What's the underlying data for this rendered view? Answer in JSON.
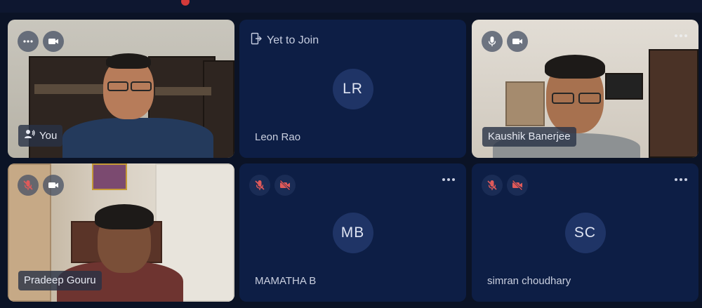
{
  "participants": [
    {
      "name": "You",
      "type": "video",
      "mic": "active",
      "camera": "on",
      "controls_icons": [
        "audio-level-icon",
        "camera-icon"
      ]
    },
    {
      "name": "Leon Rao",
      "type": "avatar",
      "initials": "LR",
      "status": "Yet to Join"
    },
    {
      "name": "Kaushik Banerjee",
      "type": "video",
      "mic": "on",
      "camera": "on"
    },
    {
      "name": "Pradeep Gouru",
      "type": "video",
      "mic": "muted",
      "camera": "on"
    },
    {
      "name": "MAMATHA B",
      "type": "avatar",
      "initials": "MB",
      "mic": "muted",
      "camera": "off"
    },
    {
      "name": "simran choudhary",
      "type": "avatar",
      "initials": "SC",
      "mic": "muted",
      "camera": "off"
    }
  ],
  "colors": {
    "background": "#0b1326",
    "tile": "#0d1e45",
    "avatar": "#1f3466",
    "muted_icon": "#e05a5a"
  }
}
